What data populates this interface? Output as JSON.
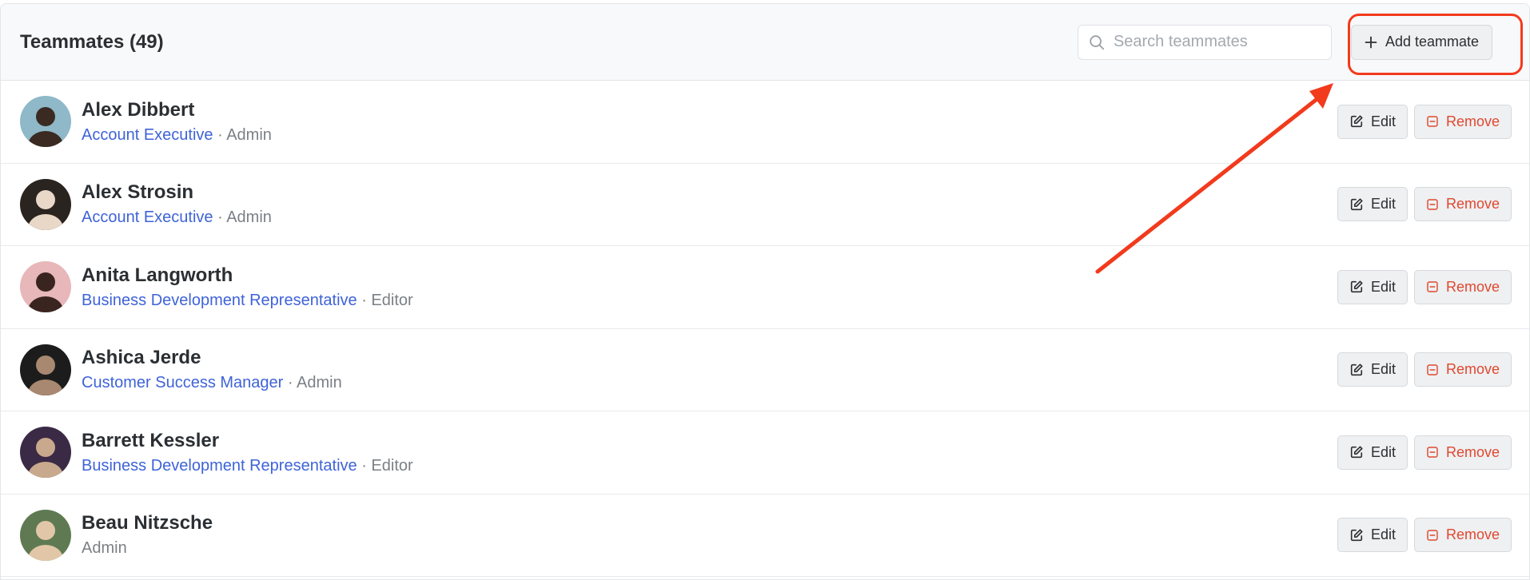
{
  "header": {
    "title": "Teammates (49)",
    "search_placeholder": "Search teammates",
    "add_label": "Add teammate"
  },
  "actions": {
    "edit_label": "Edit",
    "remove_label": "Remove"
  },
  "separator": "·",
  "teammates": [
    {
      "name": "Alex Dibbert",
      "role": "Account Executive",
      "permission": "Admin",
      "avatar_bg": "#8fb8c8",
      "avatar_fg": "#3a2a22"
    },
    {
      "name": "Alex Strosin",
      "role": "Account Executive",
      "permission": "Admin",
      "avatar_bg": "#2a2420",
      "avatar_fg": "#e9d8c8"
    },
    {
      "name": "Anita Langworth",
      "role": "Business Development Representative",
      "permission": "Editor",
      "avatar_bg": "#e7b7b9",
      "avatar_fg": "#3a2420"
    },
    {
      "name": "Ashica Jerde",
      "role": "Customer Success Manager",
      "permission": "Admin",
      "avatar_bg": "#1c1c1c",
      "avatar_fg": "#a88870"
    },
    {
      "name": "Barrett Kessler",
      "role": "Business Development Representative",
      "permission": "Editor",
      "avatar_bg": "#3b2a45",
      "avatar_fg": "#c9a98e"
    },
    {
      "name": "Beau Nitzsche",
      "role": "",
      "permission": "Admin",
      "avatar_bg": "#5f7a52",
      "avatar_fg": "#e2c6a8"
    }
  ],
  "colors": {
    "accent": "#3f63d8",
    "danger": "#e0482f",
    "annotation": "#f23a1d"
  }
}
